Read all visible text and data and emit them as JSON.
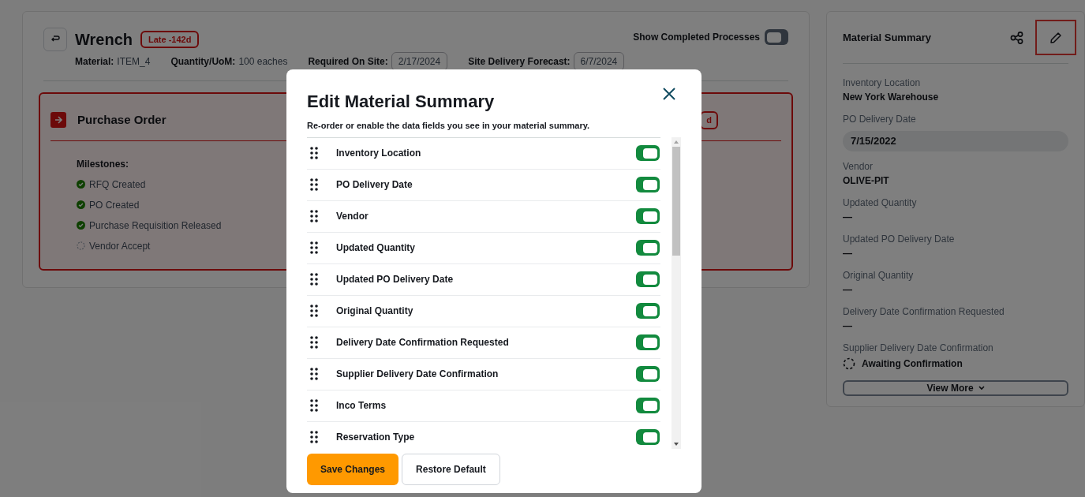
{
  "item": {
    "title": "Wrench",
    "badge": "Late -142d",
    "fields": [
      {
        "label": "Material:",
        "value": "ITEM_4",
        "kind": "text"
      },
      {
        "label": "Quantity/UoM:",
        "value": "100 eaches",
        "kind": "text"
      },
      {
        "label": "Required On Site:",
        "value": "2/17/2024",
        "kind": "date"
      },
      {
        "label": "Site Delivery Forecast:",
        "value": "6/7/2024",
        "kind": "date"
      }
    ]
  },
  "show_completed": {
    "label": "Show Completed Processes",
    "on": false
  },
  "process": {
    "title": "Purchase Order",
    "badge": "d",
    "milestones_label": "Milestones:",
    "milestones": [
      {
        "label": "RFQ Created",
        "done": true
      },
      {
        "label": "PO Created",
        "done": true
      },
      {
        "label": "Purchase Requisition Released",
        "done": true
      },
      {
        "label": "Vendor Accept",
        "done": false
      }
    ]
  },
  "summary": {
    "title": "Material Summary",
    "edit_highlighted": true,
    "fields": [
      {
        "label": "Inventory Location",
        "value": "New York Warehouse",
        "kind": "text"
      },
      {
        "label": "PO Delivery Date",
        "value": "7/15/2022",
        "kind": "chip"
      },
      {
        "label": "Vendor",
        "value": "OLIVE-PIT",
        "kind": "text"
      },
      {
        "label": "Updated Quantity",
        "value": "—",
        "kind": "text"
      },
      {
        "label": "Updated PO Delivery Date",
        "value": "—",
        "kind": "text"
      },
      {
        "label": "Original Quantity",
        "value": "—",
        "kind": "text"
      },
      {
        "label": "Delivery Date Confirmation Requested",
        "value": "—",
        "kind": "text"
      },
      {
        "label": "Supplier Delivery Date Confirmation",
        "value": "Awaiting Confirmation",
        "kind": "pending"
      }
    ],
    "view_more": "View More"
  },
  "dialog": {
    "title": "Edit Material Summary",
    "subtitle": "Re-order or enable the data fields you see in your material summary.",
    "fields": [
      {
        "label": "Inventory Location",
        "on": true
      },
      {
        "label": "PO Delivery Date",
        "on": true
      },
      {
        "label": "Vendor",
        "on": true
      },
      {
        "label": "Updated Quantity",
        "on": true
      },
      {
        "label": "Updated PO Delivery Date",
        "on": true
      },
      {
        "label": "Original Quantity",
        "on": true
      },
      {
        "label": "Delivery Date Confirmation Requested",
        "on": true
      },
      {
        "label": "Supplier Delivery Date Confirmation",
        "on": true
      },
      {
        "label": "Inco Terms",
        "on": true
      },
      {
        "label": "Reservation Type",
        "on": true
      }
    ],
    "buttons": [
      {
        "label": "Save Changes",
        "kind": "primary"
      },
      {
        "label": "Restore Default",
        "kind": "secondary"
      }
    ]
  }
}
